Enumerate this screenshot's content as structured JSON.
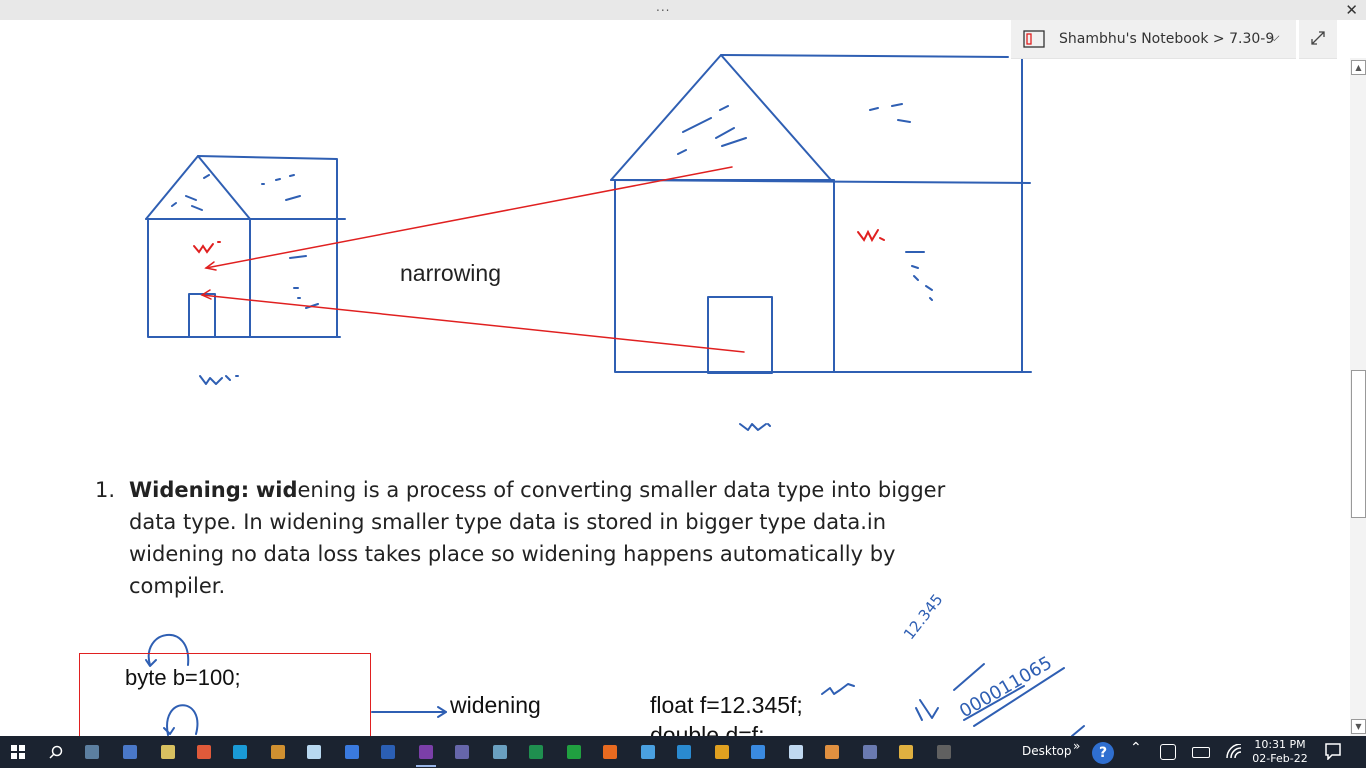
{
  "window": {
    "overflow_dots": "...",
    "close_glyph": "✕",
    "breadcrumb": "Shambhu's Notebook > 7.30-9",
    "breadcrumb_chevron": "⌵",
    "expand_icon": "expand-icon"
  },
  "scrollbar": {
    "up_glyph": "▲",
    "down_glyph": "▼"
  },
  "page": {
    "narrowing_label": "narrowing",
    "list_number": "1.",
    "widening_heading": "Widening:",
    "widening_bold_prefix": "wid",
    "widening_rest": "ening is a process of converting smaller data type into bigger data type. In widening smaller type data is stored in bigger type data.in widening no data loss takes place so widening happens automatically by compiler.",
    "code_line1": "byte b=100;",
    "widening_label": "widening",
    "float_code": "float f=12.345f;",
    "double_code": "double d=f;",
    "handwriting_1": "12.345",
    "handwriting_2": "000011065"
  },
  "colors": {
    "ink_blue": "#2f5fb3",
    "ink_red": "#e02020",
    "taskbar": "#1b2330"
  },
  "taskbar": {
    "apps": [
      {
        "name": "start-icon"
      },
      {
        "name": "search-icon"
      },
      {
        "name": "calculator-icon"
      },
      {
        "name": "keyboard-icon"
      },
      {
        "name": "notepad-icon"
      },
      {
        "name": "paint-icon"
      },
      {
        "name": "skype-icon"
      },
      {
        "name": "wordpad-icon"
      },
      {
        "name": "notes-icon"
      },
      {
        "name": "store-icon"
      },
      {
        "name": "word-icon"
      },
      {
        "name": "onenote-icon"
      },
      {
        "name": "pen-icon"
      },
      {
        "name": "paint3d-icon"
      },
      {
        "name": "pycharm-icon"
      },
      {
        "name": "sync-icon"
      },
      {
        "name": "firefox-icon"
      },
      {
        "name": "monitor-icon"
      },
      {
        "name": "edge-icon"
      },
      {
        "name": "chrome-icon"
      },
      {
        "name": "zoom-icon"
      },
      {
        "name": "snowflake-icon"
      },
      {
        "name": "gear-app-icon"
      },
      {
        "name": "pen-tool-icon"
      },
      {
        "name": "folder-icon"
      },
      {
        "name": "terminal-icon"
      }
    ],
    "desktop_label": "Desktop",
    "overflow": "»",
    "tray_chevron": "⌃",
    "time": "10:31 PM",
    "date": "02-Feb-22"
  }
}
